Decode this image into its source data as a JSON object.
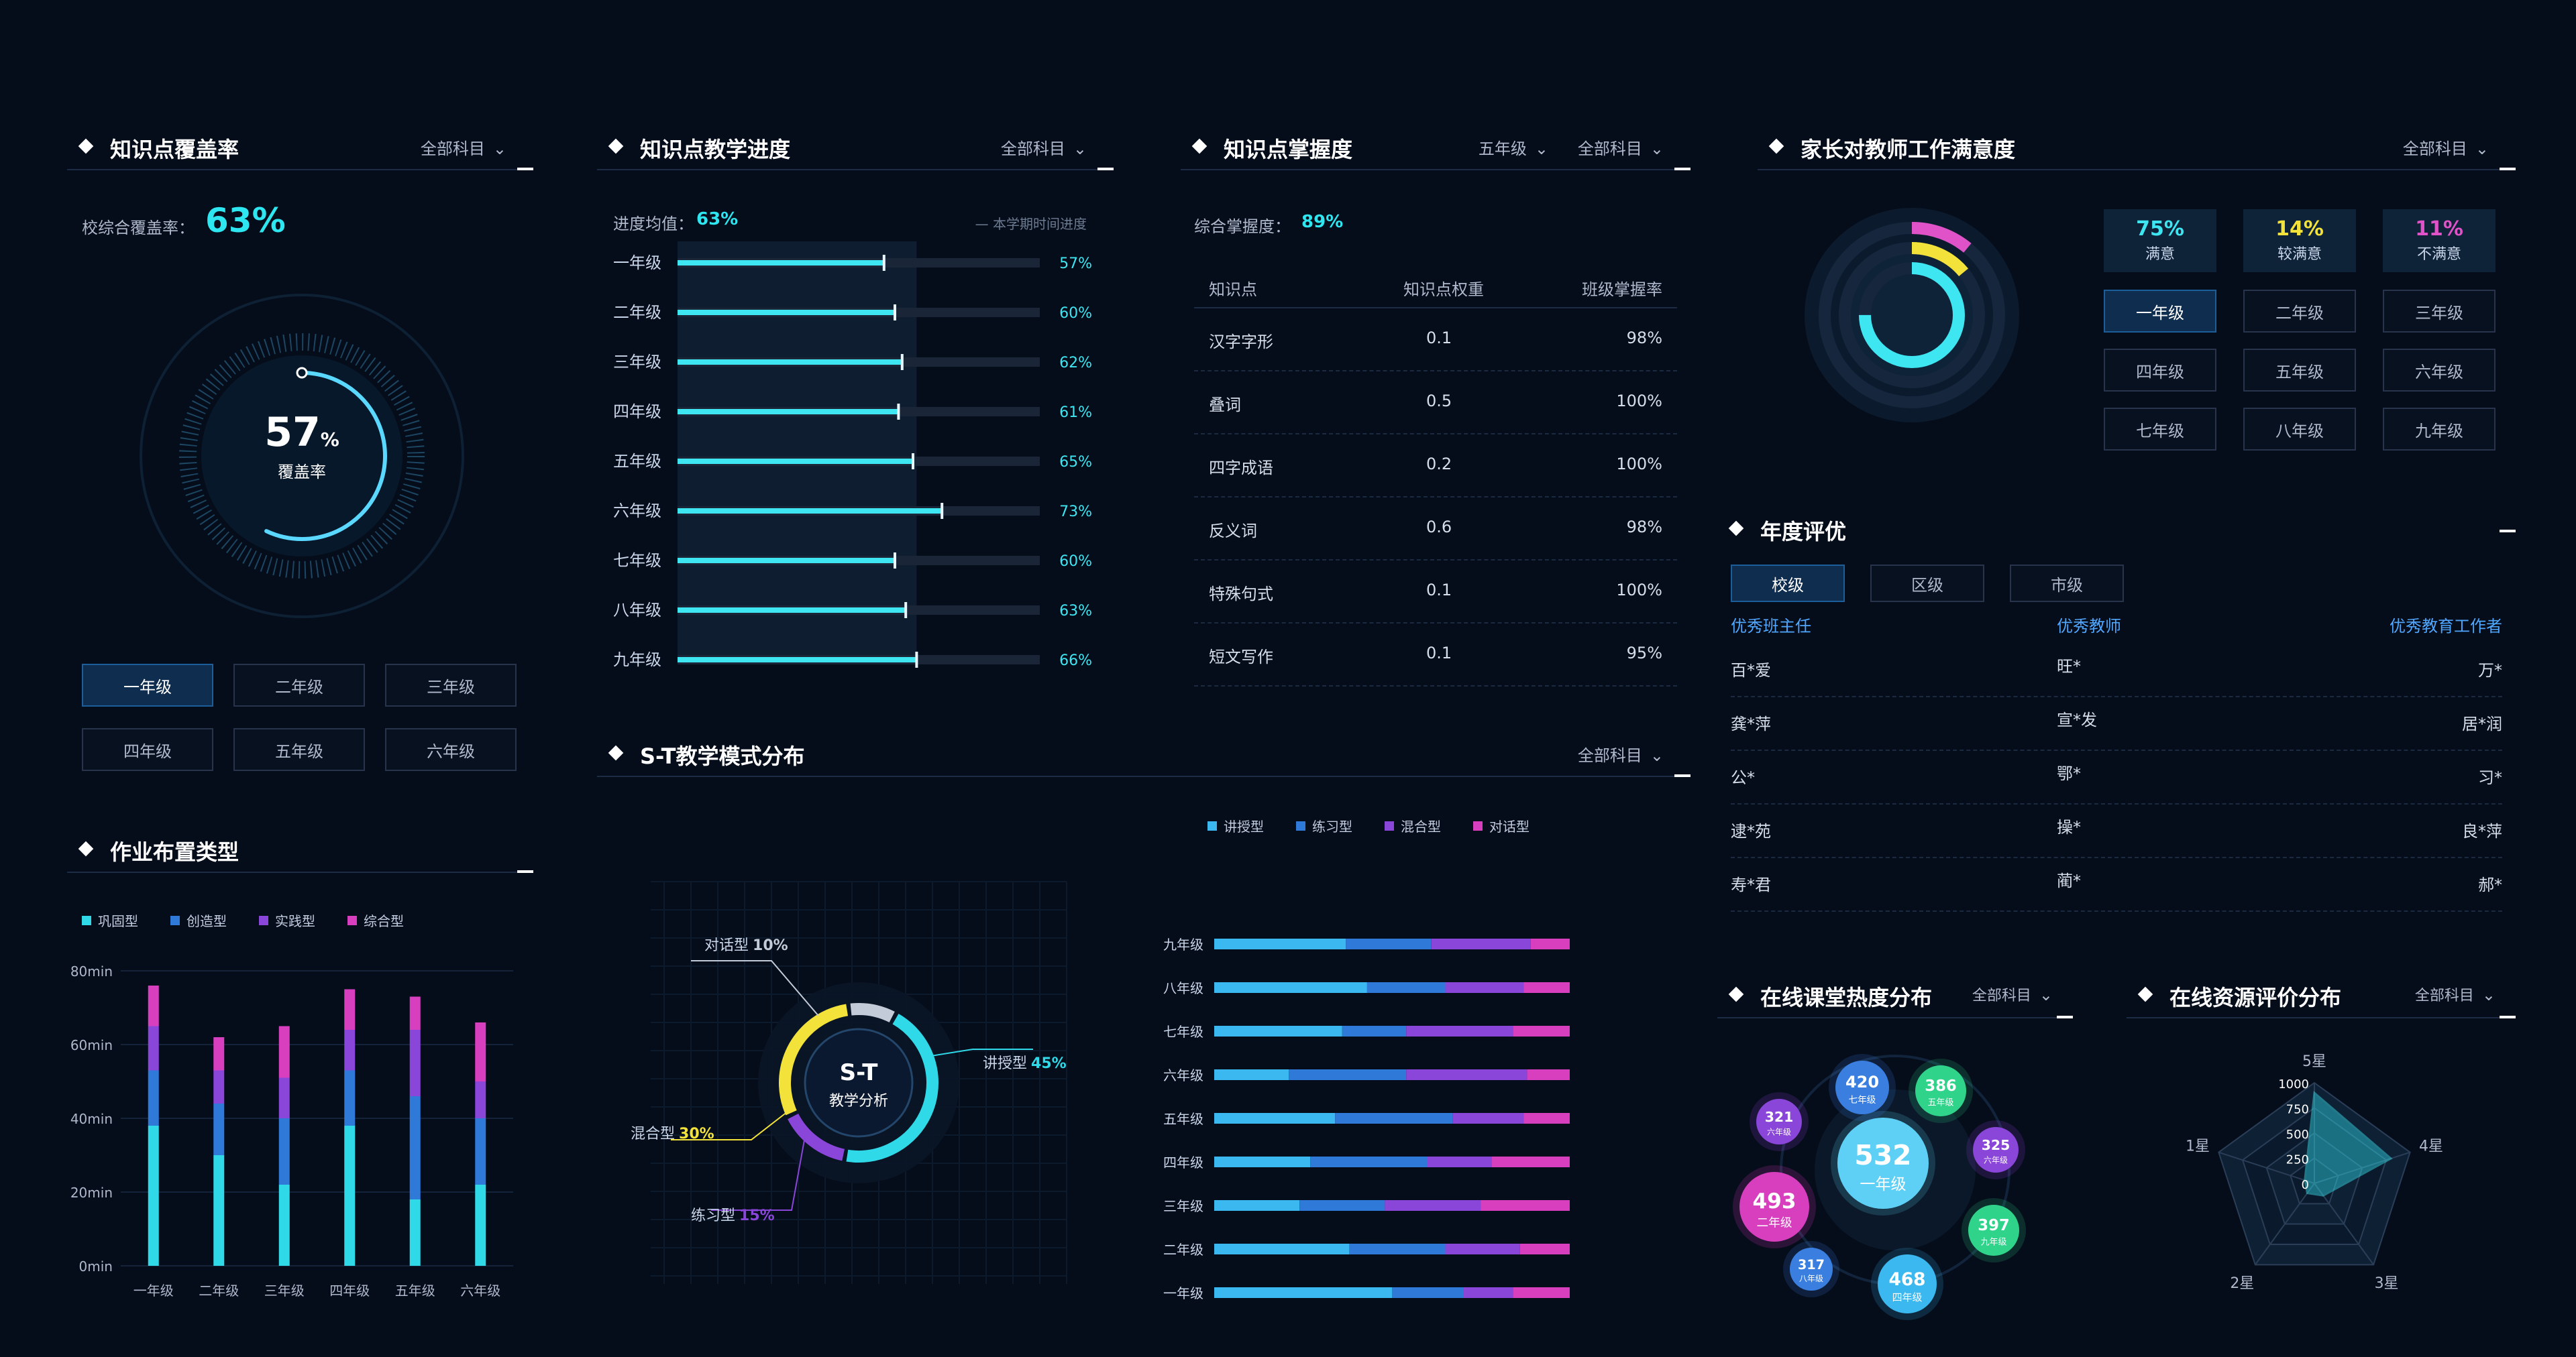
{
  "coverage": {
    "title": "知识点覆盖率",
    "filter": "全部科目",
    "school_label": "校综合覆盖率：",
    "school_value": "63%",
    "ring_value": "57",
    "ring_unit": "%",
    "ring_label": "覆盖率",
    "ring_progress": 0.57,
    "grades": [
      "一年级",
      "二年级",
      "三年级",
      "四年级",
      "五年级",
      "六年级"
    ],
    "active_grade": "一年级"
  },
  "progress": {
    "title": "知识点教学进度",
    "filter": "全部科目",
    "avg_label": "进度均值：",
    "avg_value": "63%",
    "legend": "本学期时间进度",
    "rows": [
      {
        "grade": "一年级",
        "value": 57,
        "label": "57%"
      },
      {
        "grade": "二年级",
        "value": 60,
        "label": "60%"
      },
      {
        "grade": "三年级",
        "value": 62,
        "label": "62%"
      },
      {
        "grade": "四年级",
        "value": 61,
        "label": "61%"
      },
      {
        "grade": "五年级",
        "value": 65,
        "label": "65%"
      },
      {
        "grade": "六年级",
        "value": 73,
        "label": "73%"
      },
      {
        "grade": "七年级",
        "value": 60,
        "label": "60%"
      },
      {
        "grade": "八年级",
        "value": 63,
        "label": "63%"
      },
      {
        "grade": "九年级",
        "value": 66,
        "label": "66%"
      }
    ],
    "term_progress": 66
  },
  "mastery": {
    "title": "知识点掌握度",
    "filter_grade": "五年级",
    "filter_subject": "全部科目",
    "summary_label": "综合掌握度：",
    "summary_value": "89%",
    "headers": [
      "知识点",
      "知识点权重",
      "班级掌握率"
    ],
    "rows": [
      [
        "汉字字形",
        "0.1",
        "98%"
      ],
      [
        "叠词",
        "0.5",
        "100%"
      ],
      [
        "四字成语",
        "0.2",
        "100%"
      ],
      [
        "反义词",
        "0.6",
        "98%"
      ],
      [
        "特殊句式",
        "0.1",
        "100%"
      ],
      [
        "短文写作",
        "0.1",
        "95%"
      ]
    ]
  },
  "satisfaction": {
    "title": "家长对教师工作满意度",
    "filter": "全部科目",
    "stats": [
      {
        "value": "75%",
        "label": "满意",
        "color": "#3ee6f2",
        "fraction": 0.75
      },
      {
        "value": "14%",
        "label": "较满意",
        "color": "#f2e23a",
        "fraction": 0.14
      },
      {
        "value": "11%",
        "label": "不满意",
        "color": "#e052c8",
        "fraction": 0.11
      }
    ],
    "grades": [
      "一年级",
      "二年级",
      "三年级",
      "四年级",
      "五年级",
      "六年级",
      "七年级",
      "八年级",
      "九年级"
    ],
    "active_grade": "一年级"
  },
  "annual": {
    "title": "年度评优",
    "tabs": [
      "校级",
      "区级",
      "市级"
    ],
    "active_tab": "校级",
    "headers": [
      "优秀班主任",
      "优秀教师",
      "优秀教育工作者"
    ],
    "rows": [
      [
        "百*爱",
        "旺*",
        "万*"
      ],
      [
        "龚*萍",
        "宣*发",
        "居*润"
      ],
      [
        "公*",
        "鄂*",
        "习*"
      ],
      [
        "逮*苑",
        "操*",
        "良*萍"
      ],
      [
        "寿*君",
        "蔺*",
        "郝*"
      ]
    ]
  },
  "homework": {
    "title": "作业布置类型",
    "legend": [
      "巩固型",
      "创造型",
      "实践型",
      "综合型"
    ],
    "colors": [
      "#2fd9e8",
      "#2f79d9",
      "#8a45d9",
      "#d83fbf"
    ],
    "chart_data": {
      "type": "bar",
      "stacked": true,
      "categories": [
        "一年级",
        "二年级",
        "三年级",
        "四年级",
        "五年级",
        "六年级"
      ],
      "series": [
        {
          "name": "巩固型",
          "values": [
            38,
            30,
            22,
            38,
            18,
            22
          ]
        },
        {
          "name": "创造型",
          "values": [
            15,
            14,
            18,
            15,
            28,
            18
          ]
        },
        {
          "name": "实践型",
          "values": [
            12,
            9,
            11,
            11,
            18,
            10
          ]
        },
        {
          "name": "综合型",
          "values": [
            11,
            9,
            14,
            11,
            9,
            16
          ]
        }
      ],
      "ylim": [
        0,
        80
      ],
      "yticks": [
        "0min",
        "20min",
        "40min",
        "60min",
        "80min"
      ]
    }
  },
  "st_mode": {
    "title": "S-T教学模式分布",
    "filter": "全部科目",
    "center_title": "S-T",
    "center_sub": "教学分析",
    "parts": [
      {
        "name": "讲授型",
        "value": "45%",
        "fraction": 0.45,
        "color": "#2fd9e8"
      },
      {
        "name": "练习型",
        "value": "15%",
        "fraction": 0.15,
        "color": "#8a45d9"
      },
      {
        "name": "混合型",
        "value": "30%",
        "fraction": 0.3,
        "color": "#f2e23a"
      },
      {
        "name": "对话型",
        "value": "10%",
        "fraction": 0.1,
        "color": "#c4cbd8"
      }
    ],
    "legend": [
      "讲授型",
      "练习型",
      "混合型",
      "对话型"
    ],
    "colors": [
      "#3ab8ef",
      "#2f79d9",
      "#8a45d9",
      "#d83fbf"
    ],
    "chart_data": {
      "type": "bar",
      "stacked": true,
      "orientation": "horizontal",
      "categories": [
        "九年级",
        "八年级",
        "七年级",
        "六年级",
        "五年级",
        "四年级",
        "三年级",
        "二年级",
        "一年级"
      ],
      "series": [
        {
          "name": "讲授型",
          "values": [
            37,
            43,
            36,
            21,
            34,
            27,
            24,
            38,
            50
          ]
        },
        {
          "name": "练习型",
          "values": [
            24,
            22,
            18,
            33,
            33,
            33,
            24,
            27,
            20
          ]
        },
        {
          "name": "混合型",
          "values": [
            28,
            22,
            30,
            34,
            20,
            18,
            27,
            21,
            14
          ]
        },
        {
          "name": "对话型",
          "values": [
            11,
            13,
            16,
            12,
            13,
            22,
            25,
            14,
            16
          ]
        }
      ],
      "xlim": [
        0,
        100
      ]
    }
  },
  "online": {
    "title": "在线课堂热度分布",
    "filter": "全部科目",
    "bubbles": [
      {
        "value": "532",
        "label": "一年级",
        "color": "#5fd0f5"
      },
      {
        "value": "420",
        "label": "七年级",
        "color": "#3a7fe0"
      },
      {
        "value": "386",
        "label": "五年级",
        "color": "#2fd48a"
      },
      {
        "value": "321",
        "label": "六年级",
        "color": "#8a45d9"
      },
      {
        "value": "325",
        "label": "六年级",
        "color": "#8a45d9"
      },
      {
        "value": "493",
        "label": "二年级",
        "color": "#d83fbf"
      },
      {
        "value": "397",
        "label": "九年级",
        "color": "#2fd48a"
      },
      {
        "value": "317",
        "label": "八年级",
        "color": "#3a7fe0"
      },
      {
        "value": "468",
        "label": "四年级",
        "color": "#3ab8ef"
      }
    ]
  },
  "resource": {
    "title": "在线资源评价分布",
    "filter": "全部科目",
    "chart_data": {
      "type": "radar",
      "axes": [
        "5星",
        "4星",
        "3星",
        "2星",
        "1星"
      ],
      "scale_ticks": [
        "0",
        "250",
        "500",
        "750",
        "1000"
      ],
      "max": 1000,
      "values": [
        900,
        800,
        150,
        120,
        100
      ]
    }
  }
}
